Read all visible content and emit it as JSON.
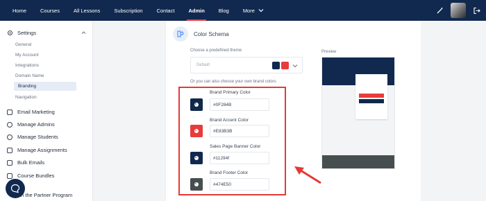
{
  "nav": {
    "items": [
      "Home",
      "Courses",
      "All Lessons",
      "Subscription",
      "Contact",
      "Admin",
      "Blog",
      "More"
    ],
    "active": "Admin"
  },
  "sidebar": {
    "group": "Settings",
    "sub_items": [
      "General",
      "My Account",
      "Integrations",
      "Domain Name",
      "Branding",
      "Navigation"
    ],
    "active_sub": "Branding",
    "items": [
      "Email Marketing",
      "Manage Admins",
      "Manage Students",
      "Manage Assignments",
      "Bulk Emails",
      "Course Bundles",
      "n the Partner Program"
    ]
  },
  "panel": {
    "title": "Color Schema",
    "theme_label": "Choose a predefined theme",
    "theme_value": "Default",
    "custom_label": "Or you can also choose your own brand colors",
    "preview_label": "Preview"
  },
  "brand_colors": [
    {
      "label": "Brand Primary Color",
      "value": "#0F284B",
      "swatch": "#0f284b"
    },
    {
      "label": "Brand Accent Color",
      "value": "#E83B3B",
      "swatch": "#e83b3b"
    },
    {
      "label": "Sales Page Banner Color",
      "value": "#11294f",
      "swatch": "#11294f"
    },
    {
      "label": "Brand Footer Color",
      "value": "#474E50",
      "swatch": "#474e50"
    }
  ],
  "colors": {
    "nav_bg": "#11294f",
    "accent": "#e83b3b",
    "highlight": "#e53935"
  }
}
